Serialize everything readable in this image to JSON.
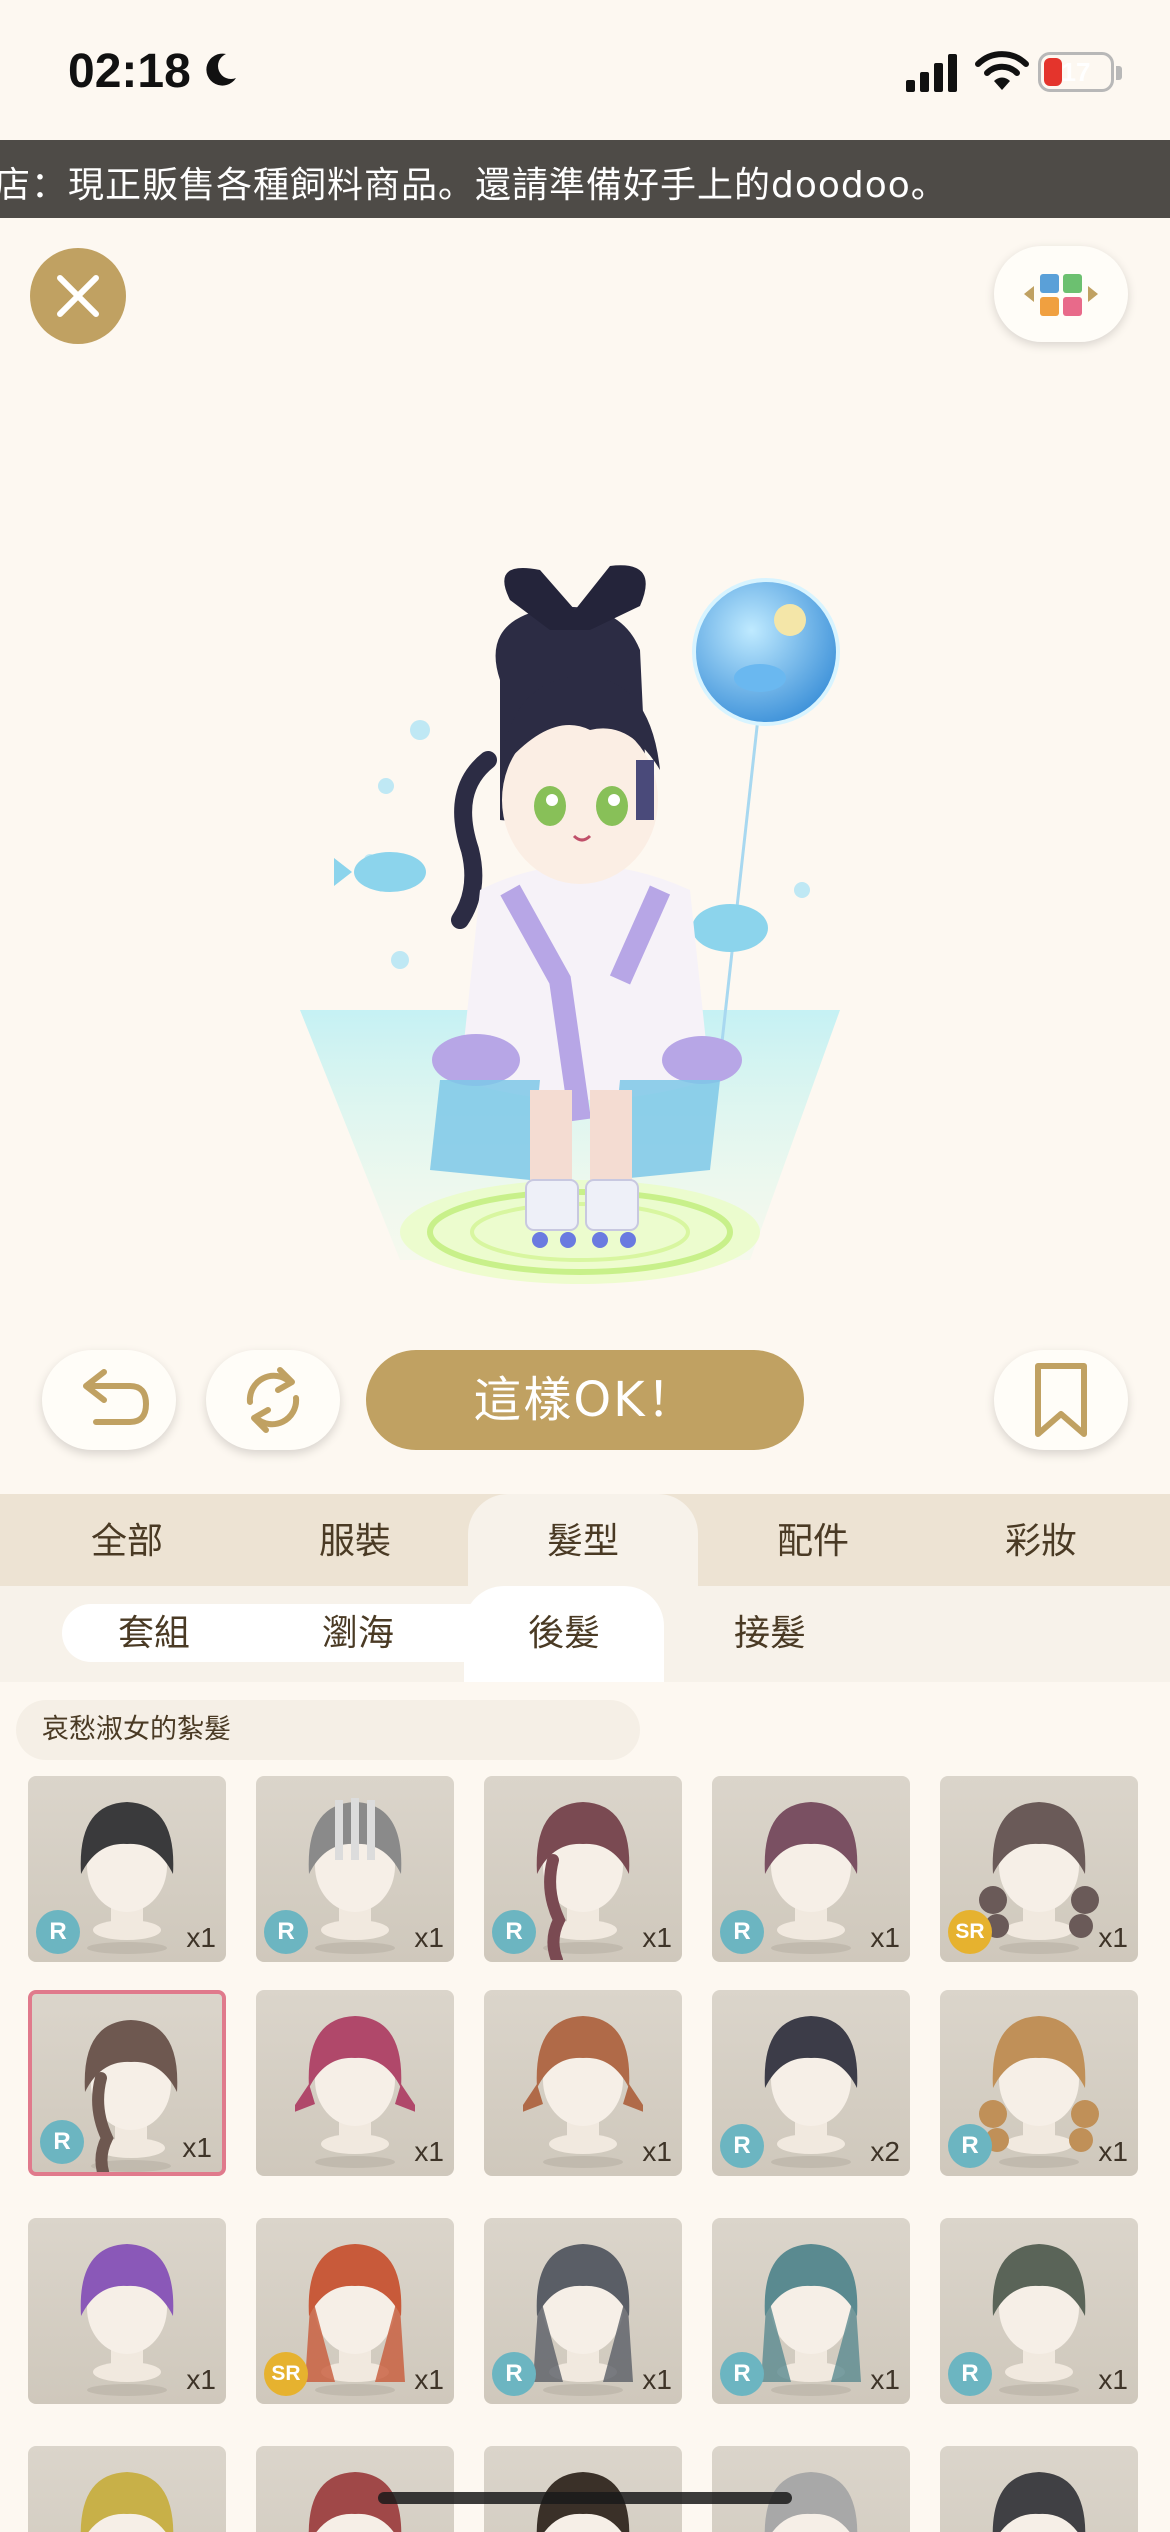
{
  "status_bar": {
    "time": "02:18",
    "battery": "17"
  },
  "ticker": {
    "text": "店：現正販售各種飼料商品。還請準備好手上的doodoo。"
  },
  "actions": {
    "ok_label": "這樣OK！"
  },
  "category_tabs": [
    {
      "label": "全部"
    },
    {
      "label": "服裝"
    },
    {
      "label": "髮型",
      "active": true
    },
    {
      "label": "配件"
    },
    {
      "label": "彩妝"
    }
  ],
  "sub_tabs": [
    {
      "label": "套組"
    },
    {
      "label": "瀏海"
    },
    {
      "label": "後髮",
      "active": true
    },
    {
      "label": "接髮"
    }
  ],
  "selected_item_name": "哀愁淑女的紮髮",
  "items": [
    {
      "rarity": "R",
      "qty": "x1",
      "hair": "#3a3a3c",
      "style": "short"
    },
    {
      "rarity": "R",
      "qty": "x1",
      "hair": "#8a8a8a",
      "style": "helmet"
    },
    {
      "rarity": "R",
      "qty": "x1",
      "hair": "#7a4a52",
      "style": "braid"
    },
    {
      "rarity": "R",
      "qty": "x1",
      "hair": "#7a5062",
      "style": "short"
    },
    {
      "rarity": "SR",
      "qty": "x1",
      "hair": "#6a5a58",
      "style": "curly"
    },
    {
      "rarity": "R",
      "qty": "x1",
      "hair": "#6e5850",
      "style": "braid",
      "selected": true
    },
    {
      "rarity": "",
      "qty": "x1",
      "hair": "#b0486a",
      "style": "twin"
    },
    {
      "rarity": "",
      "qty": "x1",
      "hair": "#b06a48",
      "style": "twin"
    },
    {
      "rarity": "R",
      "qty": "x2",
      "hair": "#3c3c48",
      "style": "short"
    },
    {
      "rarity": "R",
      "qty": "x1",
      "hair": "#c09058",
      "style": "curly"
    },
    {
      "rarity": "",
      "qty": "x1",
      "hair": "#8a58b8",
      "style": "short"
    },
    {
      "rarity": "SR",
      "qty": "x1",
      "hair": "#c85a3a",
      "style": "long"
    },
    {
      "rarity": "R",
      "qty": "x1",
      "hair": "#5a5e66",
      "style": "long"
    },
    {
      "rarity": "R",
      "qty": "x1",
      "hair": "#5a8a90",
      "style": "long"
    },
    {
      "rarity": "R",
      "qty": "x1",
      "hair": "#5a6458",
      "style": "short"
    },
    {
      "rarity": "",
      "qty": "",
      "hair": "#c8b048",
      "style": "short"
    },
    {
      "rarity": "",
      "qty": "",
      "hair": "#a04848",
      "style": "short"
    },
    {
      "rarity": "",
      "qty": "",
      "hair": "#3a3028",
      "style": "short"
    },
    {
      "rarity": "",
      "qty": "",
      "hair": "#a8a8a8",
      "style": "curly"
    },
    {
      "rarity": "",
      "qty": "",
      "hair": "#404044",
      "style": "short"
    }
  ],
  "colors": {
    "gold": "#c0a162",
    "selected_border": "#e07a8c",
    "rarity_r": "#6cb5c1",
    "rarity_sr": "#e6b22f"
  },
  "icons": [
    "moon-icon",
    "signal-icon",
    "wifi-icon",
    "battery-icon",
    "close-icon",
    "palette-icon",
    "undo-icon",
    "shuffle-icon",
    "bookmark-icon"
  ]
}
